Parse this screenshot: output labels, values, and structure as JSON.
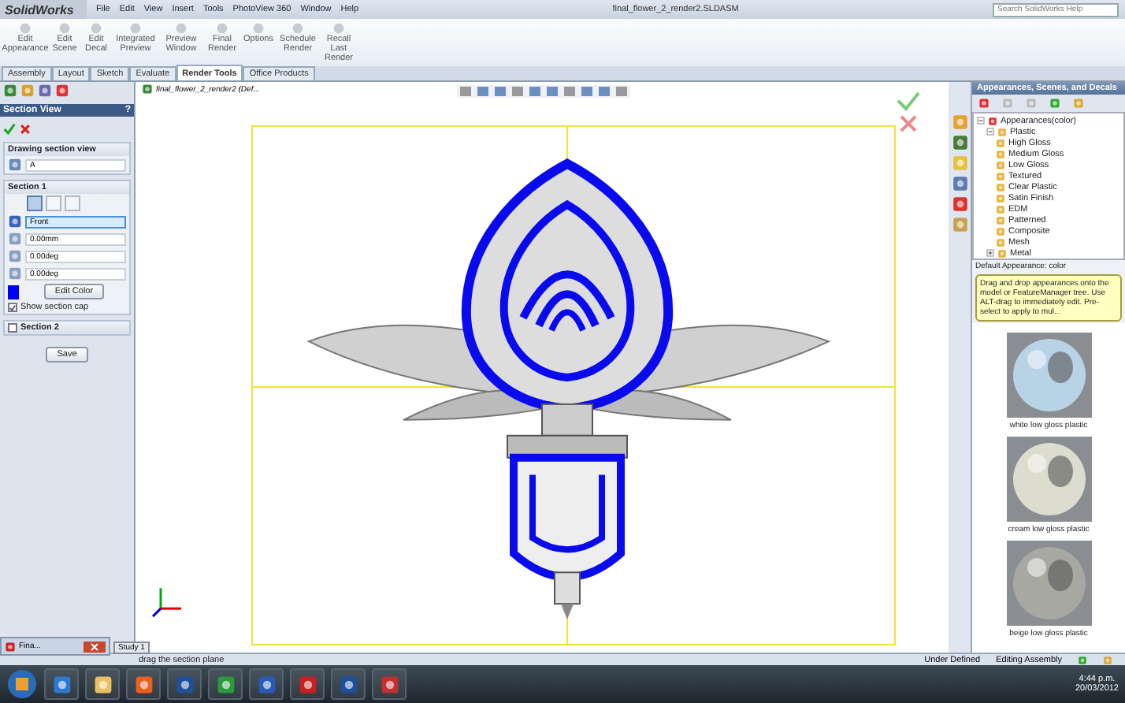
{
  "app": {
    "logo": "SolidWorks",
    "menu": [
      "File",
      "Edit",
      "View",
      "Insert",
      "Tools",
      "PhotoView 360",
      "Window",
      "Help"
    ],
    "document_title": "final_flower_2_render2.SLDASM",
    "search": {
      "placeholder": "Search SolidWorks Help"
    }
  },
  "ribbon": {
    "buttons": [
      "Edit Appearance",
      "Edit Scene",
      "Edit Decal",
      "Integrated Preview",
      "Preview Window",
      "Final Render",
      "Options",
      "Schedule Render",
      "Recall Last Render"
    ]
  },
  "tabs": [
    {
      "label": "Assembly",
      "selected": false
    },
    {
      "label": "Layout",
      "selected": false
    },
    {
      "label": "Sketch",
      "selected": false
    },
    {
      "label": "Evaluate",
      "selected": false
    },
    {
      "label": "Render Tools",
      "selected": true
    },
    {
      "label": "Office Products",
      "selected": false
    }
  ],
  "property_manager": {
    "title": "Section View",
    "help": "?",
    "drawing_group": {
      "title": "Drawing section view",
      "name": "A"
    },
    "section_1": {
      "title": "Section 1",
      "planes": [
        {
          "selected": true
        },
        {
          "selected": false
        },
        {
          "selected": false
        }
      ],
      "plane": "Front",
      "offset": "0.00mm",
      "angle_x": "0.00deg",
      "angle_y": "0.00deg",
      "edit_color": "Edit Color",
      "show_cap": {
        "label": "Show section cap",
        "checked": true
      }
    },
    "section_2": {
      "title": "Section 2",
      "checked": false
    },
    "save": "Save"
  },
  "viewport": {
    "tree_item": "final_flower_2_render2  (Def..."
  },
  "task_pane": {
    "title": "Appearances, Scenes, and Decals",
    "tree": [
      {
        "label": "Appearances(color)",
        "expanded": true,
        "children": [
          {
            "label": "Plastic",
            "expanded": true,
            "children": [
              {
                "label": "High Gloss"
              },
              {
                "label": "Medium Gloss"
              },
              {
                "label": "Low Gloss"
              },
              {
                "label": "Textured"
              },
              {
                "label": "Clear Plastic"
              },
              {
                "label": "Satin Finish"
              },
              {
                "label": "EDM"
              },
              {
                "label": "Patterned"
              },
              {
                "label": "Composite"
              },
              {
                "label": "Mesh"
              }
            ]
          },
          {
            "label": "Metal",
            "expanded": false
          }
        ]
      }
    ],
    "default_label": "Default Appearance:  color",
    "tip": "Drag and drop appearances onto the model or FeatureManager tree.  Use ALT-drag to immediately edit.  Pre-select to apply to mul...",
    "swatches": [
      {
        "label": "white low gloss plastic",
        "color": "#b9d3e6"
      },
      {
        "label": "cream low gloss plastic",
        "color": "#dcdccf"
      },
      {
        "label": "beige low gloss plastic",
        "color": "#a8a8a2"
      }
    ]
  },
  "mini_window": {
    "title": "Fina..."
  },
  "status_bar": {
    "study_tab": "Study 1",
    "hint": "drag the section plane",
    "items": [
      "Under Defined",
      "Editing Assembly"
    ]
  },
  "taskbar": {
    "time": "4:44 p.m.",
    "date": "20/03/2012"
  }
}
